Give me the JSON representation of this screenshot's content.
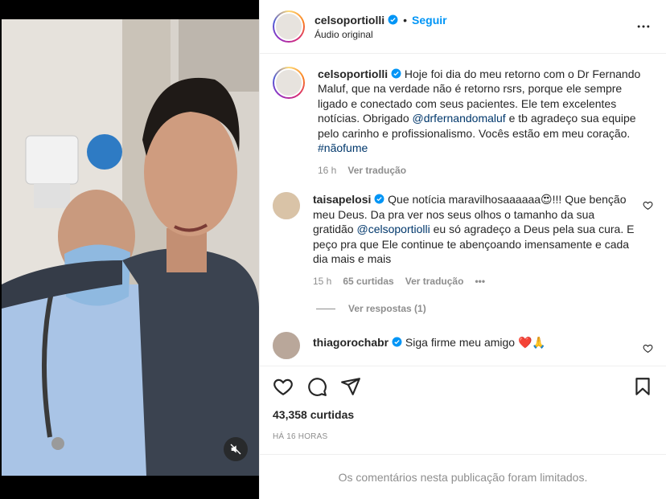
{
  "header": {
    "username": "celsoportiolli",
    "separator": "•",
    "follow_label": "Seguir",
    "audio_label": "Áudio original"
  },
  "caption": {
    "username": "celsoportiolli",
    "text_1": "Hoje foi dia do meu retorno com o Dr Fernando Maluf, que na verdade não é retorno rsrs, porque ele sempre ligado e conectado com seus pacientes. Ele tem excelentes notícias. Obrigado ",
    "mention": "@drfernandomaluf",
    "text_2": " e tb agradeço sua equipe pelo carinho e profissionalismo. Vocês estão em meu coração. ",
    "hashtag": "#nãofume",
    "time": "16 h",
    "translate": "Ver tradução"
  },
  "comments": [
    {
      "username": "taisapelosi",
      "text_1": "Que notícia maravilhosaaaaaa😍!!! Que benção meu Deus. Da pra ver nos seus olhos o tamanho da sua gratidão ",
      "mention": "@celsoportiolli",
      "text_2": " eu só agradeço a Deus pela sua cura. E peço pra que Ele continue te abençoando imensamente e cada dia mais e mais",
      "time": "15 h",
      "likes": "65 curtidas",
      "translate": "Ver tradução",
      "more": "•••",
      "replies": "Ver respostas (1)"
    },
    {
      "username": "thiagorochabr",
      "text": "Siga firme meu amigo ❤️🙏"
    }
  ],
  "post": {
    "likes": "43,358 curtidas",
    "time": "HÁ 16 HORAS",
    "limited_notice": "Os comentários nesta publicação foram limitados."
  },
  "colors": {
    "accent_blue": "#0095f6",
    "mention": "#00376b",
    "muted": "#8e8e8e"
  },
  "icons": [
    "verified-icon",
    "more-options-icon",
    "heart-icon",
    "comment-icon",
    "share-icon",
    "bookmark-icon",
    "muted-audio-icon"
  ]
}
